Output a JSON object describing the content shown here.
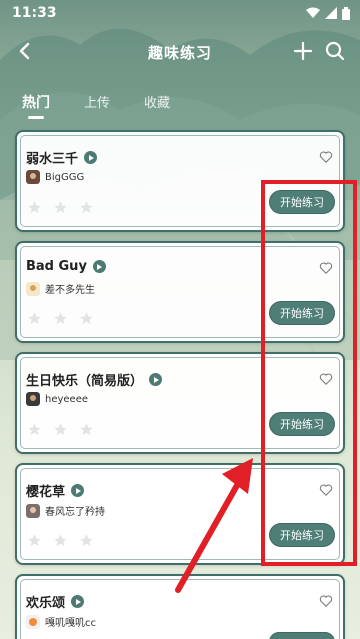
{
  "status": {
    "time": "11:33"
  },
  "app": {
    "title": "趣味练习"
  },
  "tabs": [
    {
      "label": "热门",
      "active": true
    },
    {
      "label": "上传",
      "active": false
    },
    {
      "label": "收藏",
      "active": false
    }
  ],
  "cards": [
    {
      "title": "弱水三千",
      "author": "BigGGG",
      "button": "开始练习",
      "rating": 0
    },
    {
      "title": "Bad Guy",
      "author": "差不多先生",
      "button": "开始练习",
      "rating": 0
    },
    {
      "title": "生日快乐（简易版）",
      "author": "heyeeee",
      "button": "开始练习",
      "rating": 0
    },
    {
      "title": "樱花草",
      "author": "春风忘了矜持",
      "button": "开始练习",
      "rating": 0
    },
    {
      "title": "欢乐颂",
      "author": "嘎叽嘎叽cc",
      "button": "",
      "rating": 0
    }
  ],
  "colors": {
    "accent": "#4f7e76",
    "annotation": "#e01f26"
  }
}
